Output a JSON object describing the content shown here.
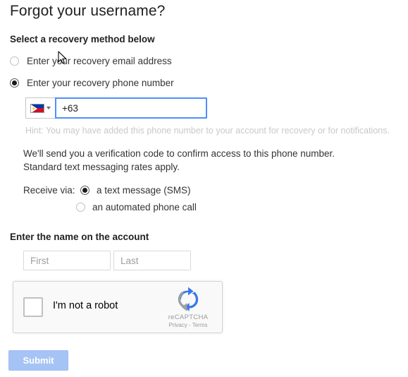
{
  "page": {
    "title": "Forgot your username?"
  },
  "recovery_method": {
    "heading": "Select a recovery method below",
    "options": [
      {
        "label": "Enter your recovery email address",
        "selected": false
      },
      {
        "label": "Enter your recovery phone number",
        "selected": true
      }
    ]
  },
  "phone": {
    "country_flag_icon": "philippines-flag-icon",
    "country_caret_icon": "chevron-down-icon",
    "value": "+63",
    "placeholder": "",
    "hint": "Hint: You may have added this phone number to your account for recovery or for notifications.",
    "info_line1": "We'll send you a verification code to confirm access to this phone number.",
    "info_line2": "Standard text messaging rates apply."
  },
  "receive_via": {
    "label": "Receive via:",
    "options": [
      {
        "label": "a text message (SMS)",
        "selected": true
      },
      {
        "label": "an automated phone call",
        "selected": false
      }
    ]
  },
  "name_section": {
    "heading": "Enter the name on the account",
    "first_placeholder": "First",
    "first_value": "",
    "last_placeholder": "Last",
    "last_value": ""
  },
  "recaptcha": {
    "checkbox_label": "I'm not a robot",
    "brand": "reCAPTCHA",
    "links": "Privacy - Terms",
    "logo_icon": "recaptcha-logo-icon",
    "checked": false
  },
  "submit": {
    "label": "Submit"
  },
  "colors": {
    "accent_blue": "#4d90fe",
    "submit_blue": "#a6c3f5",
    "hint_grey": "#c9c9c9",
    "flag_blue": "#0038a8",
    "flag_red": "#ce1126",
    "flag_yellow": "#fcd116",
    "recaptcha_blue": "#3a79e8",
    "recaptcha_grey": "#9aa0a6"
  }
}
